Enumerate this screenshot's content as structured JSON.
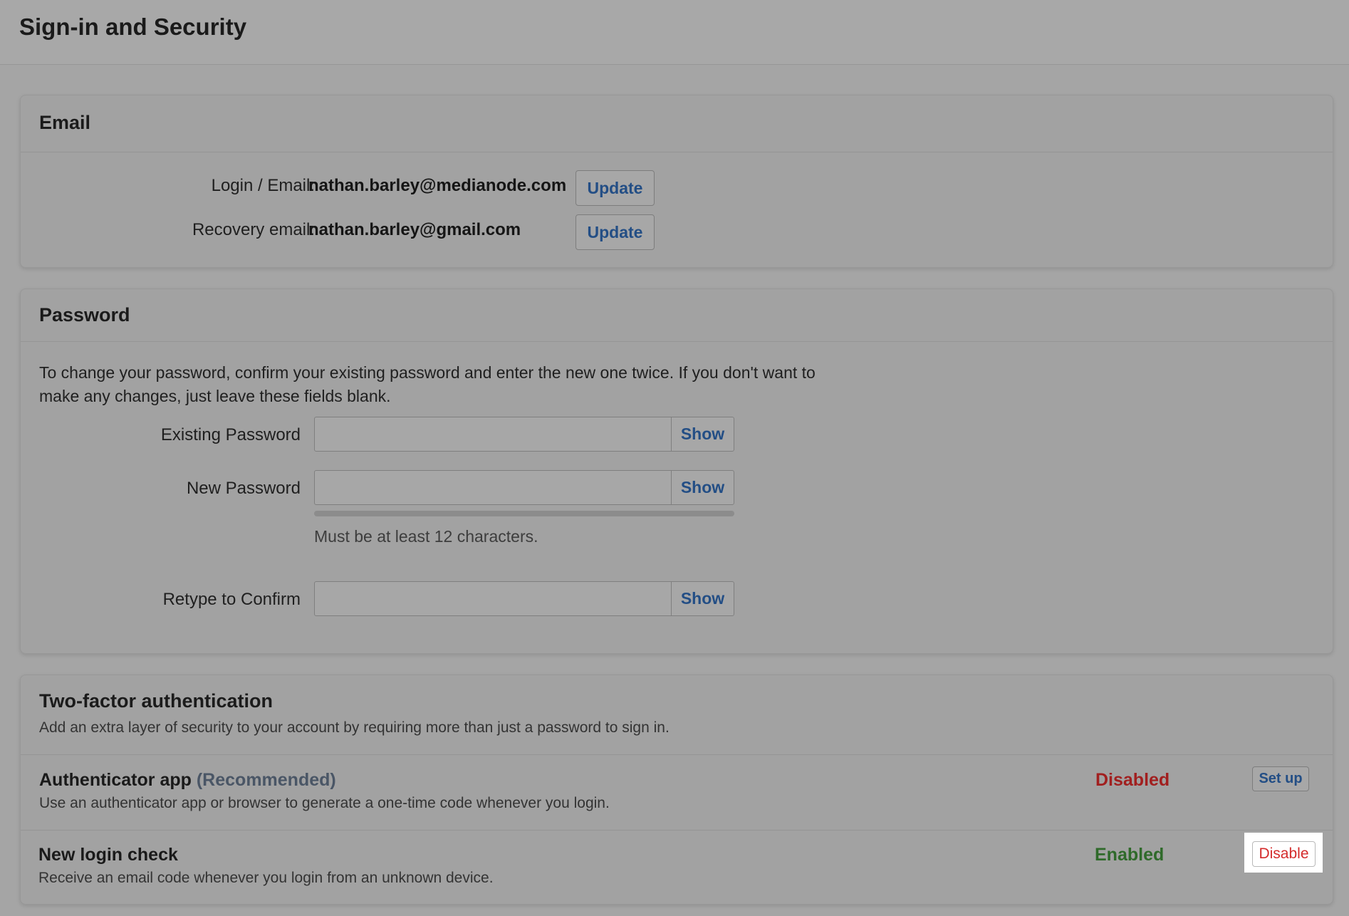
{
  "page": {
    "title": "Sign-in and Security"
  },
  "email": {
    "section_title": "Email",
    "login_label": "Login / Email:",
    "login_value": "nathan.barley@medianode.com",
    "login_button": "Update",
    "recovery_label": "Recovery email:",
    "recovery_value": "nathan.barley@gmail.com",
    "recovery_button": "Update"
  },
  "password": {
    "section_title": "Password",
    "instructions_line1": "To change your password, confirm your existing password and enter the new one twice. If you don't want to",
    "instructions_line2": "make any changes, just leave these fields blank.",
    "existing_label": "Existing Password",
    "existing_value": "",
    "new_label": "New Password",
    "new_value": "",
    "new_hint": "Must be at least 12 characters.",
    "confirm_label": "Retype to Confirm",
    "confirm_value": "",
    "show_label": "Show"
  },
  "two_factor": {
    "section_title": "Two-factor authentication",
    "section_desc": "Add an extra layer of security to your account by requiring more than just a password to sign in.",
    "methods": [
      {
        "name": "Authenticator app",
        "tag": "(Recommended)",
        "description": "Use an authenticator app or browser to generate a one-time code whenever you login.",
        "status": "Disabled",
        "action": "Set up"
      },
      {
        "name": "New login check",
        "tag": "",
        "description": "Receive an email code whenever you login from an unknown device.",
        "status": "Enabled",
        "action": "Disable"
      }
    ]
  },
  "colors": {
    "background": "#a5a5a5",
    "link_blue": "#234e85",
    "status_disabled": "#a11f1f",
    "status_enabled": "#2f6a2a",
    "danger_red": "#d42b2b"
  }
}
